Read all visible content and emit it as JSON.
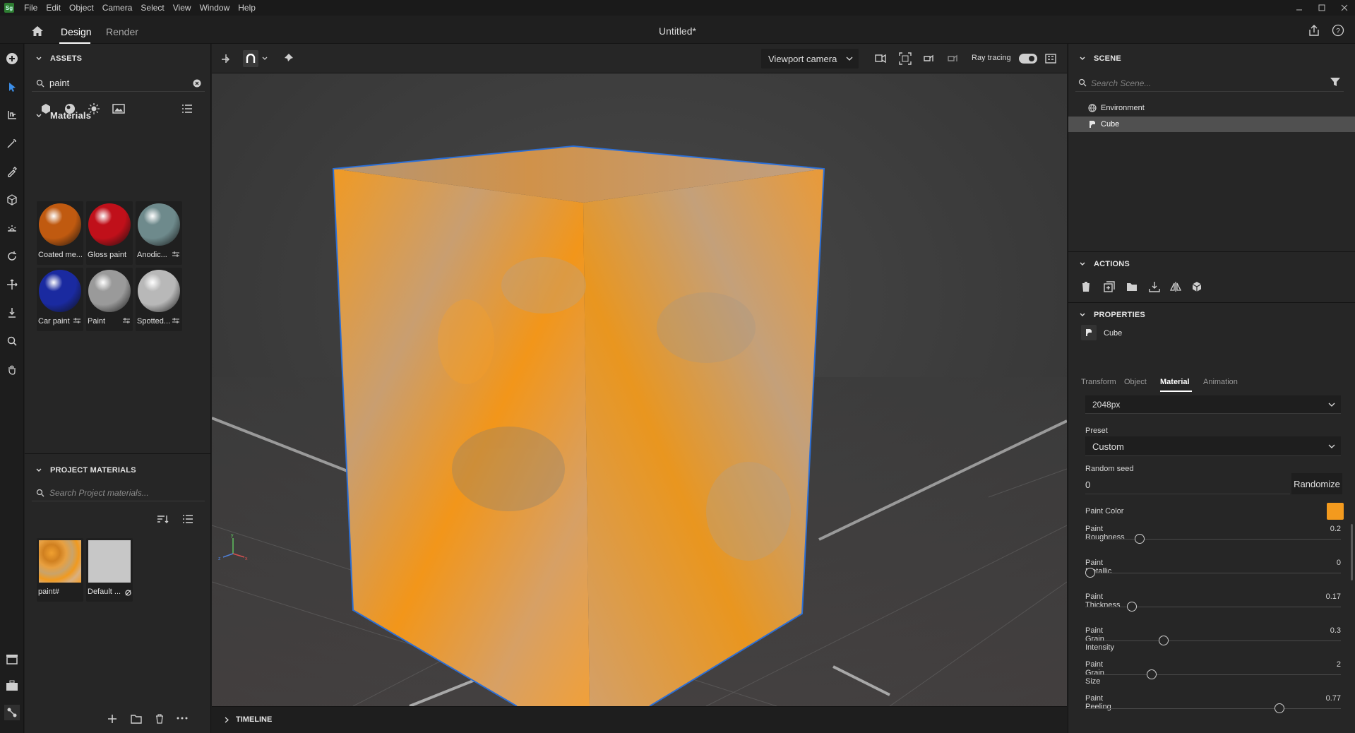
{
  "menubar": {
    "logo": "Sg",
    "items": [
      "File",
      "Edit",
      "Object",
      "Camera",
      "Select",
      "View",
      "Window",
      "Help"
    ]
  },
  "header": {
    "tabs": [
      "Design",
      "Render"
    ],
    "active_tab": "Design",
    "document_title": "Untitled*"
  },
  "assets": {
    "title": "ASSETS",
    "search_value": "paint",
    "materials_title": "Materials",
    "materials": [
      {
        "label": "Coated me...",
        "color": "#c05a10"
      },
      {
        "label": "Gloss paint",
        "color": "#c0101a"
      },
      {
        "label": "Anodic...",
        "color": "#6e8a8c"
      },
      {
        "label": "Car paint",
        "color": "#1a2aa0"
      },
      {
        "label": "Paint",
        "color": "#9a9a9a"
      },
      {
        "label": "Spotted...",
        "color": "#b8b8b8"
      }
    ],
    "project_materials_title": "PROJECT MATERIALS",
    "project_search_placeholder": "Search Project materials...",
    "project_materials": [
      {
        "label": "paint#"
      },
      {
        "label": "Default ..."
      }
    ]
  },
  "viewport": {
    "camera_select": "Viewport camera",
    "ray_tracing_label": "Ray tracing",
    "ray_tracing_on": true,
    "timeline_title": "TIMELINE"
  },
  "scene": {
    "title": "SCENE",
    "search_placeholder": "Search Scene...",
    "items": [
      "Environment",
      "Cube"
    ],
    "selected": "Cube"
  },
  "actions": {
    "title": "ACTIONS",
    "icons": [
      "trash-icon",
      "duplicate-icon",
      "folder-icon",
      "export-icon",
      "mirror-icon",
      "cube-icon"
    ]
  },
  "properties": {
    "title": "PROPERTIES",
    "object_name": "Cube",
    "tabs": [
      "Transform",
      "Object",
      "Material",
      "Animation"
    ],
    "active_tab": "Material",
    "resolution": "2048px",
    "preset_label": "Preset",
    "preset_value": "Custom",
    "random_seed_label": "Random seed",
    "random_seed_value": "0",
    "randomize_label": "Randomize",
    "paint_color_label": "Paint Color",
    "paint_color": "#f39a1e",
    "sliders": [
      {
        "label": "Paint Roughness",
        "value": "0.2",
        "fraction": 0.2
      },
      {
        "label": "Paint Metallic",
        "value": "0",
        "fraction": 0.0
      },
      {
        "label": "Paint Thickness",
        "value": "0.17",
        "fraction": 0.17
      },
      {
        "label": "Paint Grain Intensity",
        "value": "0.3",
        "fraction": 0.3
      },
      {
        "label": "Paint Grain Size",
        "value": "2",
        "fraction": 0.25
      },
      {
        "label": "Paint Peeling",
        "value": "0.77",
        "fraction": 0.77
      }
    ]
  },
  "colors": {
    "accent": "#f39a1e",
    "selection_outline": "#2c6fd6",
    "panel": "#262626"
  }
}
